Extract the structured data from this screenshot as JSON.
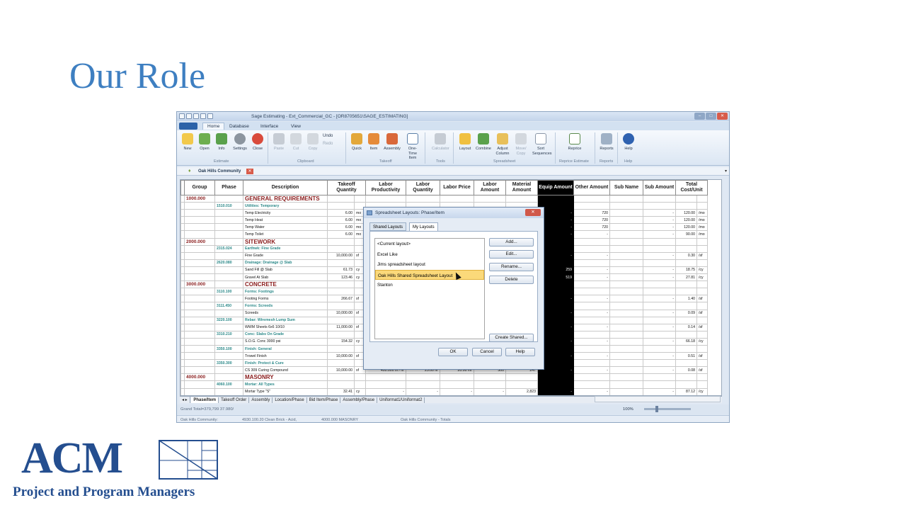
{
  "slide": {
    "title": "Our Role"
  },
  "window": {
    "title": "Sage Estimating - Ext_Commercial_GC - [OR8705651\\SAGE_ESTIMATING]",
    "min_btn": "–",
    "max_btn": "□",
    "close_btn": "✕"
  },
  "ribbon": {
    "tabs": [
      "Home",
      "Database",
      "Interface",
      "View"
    ],
    "buttons": {
      "new": "New",
      "open": "Open",
      "info": "Info",
      "settings": "Settings",
      "close": "Close",
      "paste": "Paste",
      "cut": "Cut",
      "copy": "Copy",
      "undo": "Undo",
      "redo": "Redo",
      "quick": "Quick",
      "item": "Item",
      "assembly": "Assembly",
      "onetime": "One-Time Item",
      "calculator": "Calculator",
      "layout": "Layout",
      "combine": "Combine",
      "adjust": "Adjust Column",
      "movecopy": "Move/ Copy",
      "sort": "Sort Sequences",
      "reprice": "Reprice",
      "reports": "Reports",
      "help": "Help"
    },
    "groups": {
      "estimate": "Estimate",
      "clipboard": "Clipboard",
      "takeoff": "Takeoff",
      "tools": "Tools",
      "spreadsheet": "Spreadsheet",
      "reprice": "Reprice Estimate",
      "reports": "Reports",
      "help": "Help"
    }
  },
  "estimate_bar": {
    "name": "Oak Hills Community",
    "close": "✕",
    "arrow": "▾"
  },
  "grid": {
    "headers": [
      "Group",
      "Phase",
      "Description",
      "Takeoff Quantity",
      "Labor Productivity",
      "Labor Quantity",
      "Labor Price",
      "Labor Amount",
      "Material Amount",
      "Equip Amount",
      "Other Amount",
      "Sub Name",
      "Sub Amount",
      "Total Cost/Unit"
    ],
    "rows": [
      {
        "g": "1000.000",
        "p": "",
        "d": "GENERAL REQUIREMENTS",
        "t": "",
        "u": "",
        "lp": "",
        "lq": "",
        "lpr": "",
        "la": "",
        "ma": "",
        "ea": "",
        "oa": "",
        "sn": "",
        "sa": "",
        "tc": "",
        "tu": "",
        "lvl": 1
      },
      {
        "g": "",
        "p": "1510.010",
        "d": "Utilities: Temporary",
        "t": "",
        "u": "",
        "lp": "",
        "lq": "",
        "lpr": "",
        "la": "",
        "ma": "",
        "ea": "",
        "oa": "",
        "sn": "",
        "sa": "",
        "tc": "",
        "tu": "",
        "lvl": 2
      },
      {
        "g": "",
        "p": "",
        "d": "Temp Electricity",
        "t": "6.00",
        "u": "mo",
        "lp": "",
        "lq": "",
        "lpr": "",
        "la": "",
        "ma": "",
        "ea": "-",
        "oa": "720",
        "sn": "",
        "sa": "-",
        "tc": "120.00",
        "tu": "/mo",
        "lvl": 3
      },
      {
        "g": "",
        "p": "",
        "d": "Temp Heat",
        "t": "6.00",
        "u": "mo",
        "lp": "",
        "lq": "",
        "lpr": "",
        "la": "",
        "ma": "",
        "ea": "-",
        "oa": "720",
        "sn": "",
        "sa": "-",
        "tc": "120.00",
        "tu": "/mo",
        "lvl": 3
      },
      {
        "g": "",
        "p": "",
        "d": "Temp Water",
        "t": "6.00",
        "u": "mo",
        "lp": "",
        "lq": "",
        "lpr": "",
        "la": "",
        "ma": "",
        "ea": "-",
        "oa": "720",
        "sn": "",
        "sa": "-",
        "tc": "120.00",
        "tu": "/mo",
        "lvl": 3
      },
      {
        "g": "",
        "p": "",
        "d": "Temp Toilet",
        "t": "6.00",
        "u": "mo",
        "lp": "",
        "lq": "",
        "lpr": "",
        "la": "",
        "ma": "",
        "ea": "-",
        "oa": "-",
        "sn": "",
        "sa": "-",
        "tc": "90.00",
        "tu": "/mo",
        "lvl": 3
      },
      {
        "g": "2000.000",
        "p": "",
        "d": "SITEWORK",
        "t": "",
        "u": "",
        "lp": "",
        "lq": "",
        "lpr": "",
        "la": "",
        "ma": "",
        "ea": "",
        "oa": "",
        "sn": "",
        "sa": "",
        "tc": "",
        "tu": "",
        "lvl": 1
      },
      {
        "g": "",
        "p": "2315.024",
        "d": "Earthwk: Fine Grade",
        "t": "",
        "u": "",
        "lp": "",
        "lq": "",
        "lpr": "",
        "la": "",
        "ma": "",
        "ea": "",
        "oa": "",
        "sn": "",
        "sa": "",
        "tc": "",
        "tu": "",
        "lvl": 2
      },
      {
        "g": "",
        "p": "",
        "d": "Fine Grade",
        "t": "10,000.00",
        "u": "sf",
        "lp": "",
        "lq": "",
        "lpr": "",
        "la": "",
        "ma": "",
        "ea": "-",
        "oa": "-",
        "sn": "",
        "sa": "-",
        "tc": "0.30",
        "tu": "/sf",
        "lvl": 3
      },
      {
        "g": "",
        "p": "2620.080",
        "d": "Drainage: Drainage @ Slab",
        "t": "",
        "u": "",
        "lp": "",
        "lq": "",
        "lpr": "",
        "la": "",
        "ma": "",
        "ea": "",
        "oa": "",
        "sn": "",
        "sa": "",
        "tc": "",
        "tu": "",
        "lvl": 2
      },
      {
        "g": "",
        "p": "",
        "d": "Sand Fill @ Slab",
        "t": "61.73",
        "u": "cy",
        "lp": "",
        "lq": "",
        "lpr": "",
        "la": "",
        "ma": "",
        "ea": "259",
        "oa": "-",
        "sn": "",
        "sa": "-",
        "tc": "18.75",
        "tu": "/cy",
        "lvl": 3
      },
      {
        "g": "",
        "p": "",
        "d": "Gravel At Slab",
        "t": "123.46",
        "u": "cy",
        "lp": "",
        "lq": "",
        "lpr": "",
        "la": "",
        "ma": "",
        "ea": "519",
        "oa": "-",
        "sn": "",
        "sa": "-",
        "tc": "27.81",
        "tu": "/cy",
        "lvl": 3
      },
      {
        "g": "3000.000",
        "p": "",
        "d": "CONCRETE",
        "t": "",
        "u": "",
        "lp": "",
        "lq": "",
        "lpr": "",
        "la": "",
        "ma": "",
        "ea": "",
        "oa": "",
        "sn": "",
        "sa": "",
        "tc": "",
        "tu": "",
        "lvl": 1
      },
      {
        "g": "",
        "p": "3110.100",
        "d": "Forms: Footings",
        "t": "",
        "u": "",
        "lp": "",
        "lq": "",
        "lpr": "",
        "la": "",
        "ma": "",
        "ea": "",
        "oa": "",
        "sn": "",
        "sa": "",
        "tc": "",
        "tu": "",
        "lvl": 2
      },
      {
        "g": "",
        "p": "",
        "d": "Footing Forms",
        "t": "266.67",
        "u": "sf",
        "lp": "",
        "lq": "",
        "lpr": "",
        "la": "",
        "ma": "",
        "ea": "-",
        "oa": "-",
        "sn": "",
        "sa": "-",
        "tc": "1.40",
        "tu": "/sf",
        "lvl": 3
      },
      {
        "g": "",
        "p": "3111.450",
        "d": "Forms: Screeds",
        "t": "",
        "u": "",
        "lp": "",
        "lq": "",
        "lpr": "",
        "la": "",
        "ma": "",
        "ea": "",
        "oa": "",
        "sn": "",
        "sa": "",
        "tc": "",
        "tu": "",
        "lvl": 2
      },
      {
        "g": "",
        "p": "",
        "d": "Screeds",
        "t": "10,000.00",
        "u": "sf",
        "lp": "",
        "lq": "",
        "lpr": "",
        "la": "",
        "ma": "",
        "ea": "-",
        "oa": "-",
        "sn": "",
        "sa": "-",
        "tc": "0.09",
        "tu": "/sf",
        "lvl": 3
      },
      {
        "g": "",
        "p": "3220.100",
        "d": "Rebar: Wiremesh Lump Sum",
        "t": "",
        "u": "",
        "lp": "",
        "lq": "",
        "lpr": "",
        "la": "",
        "ma": "",
        "ea": "",
        "oa": "",
        "sn": "",
        "sa": "",
        "tc": "",
        "tu": "",
        "lvl": 2
      },
      {
        "g": "",
        "p": "",
        "d": "WWM Sheets 6x6 10/10",
        "t": "11,000.00",
        "u": "sf",
        "lp": "",
        "lq": "",
        "lpr": "",
        "la": "",
        "ma": "",
        "ea": "-",
        "oa": "-",
        "sn": "",
        "sa": "-",
        "tc": "0.14",
        "tu": "/sf",
        "lvl": 3
      },
      {
        "g": "",
        "p": "3310.210",
        "d": "Conc: Slabs On Grade",
        "t": "",
        "u": "",
        "lp": "",
        "lq": "",
        "lpr": "",
        "la": "",
        "ma": "",
        "ea": "",
        "oa": "",
        "sn": "",
        "sa": "",
        "tc": "",
        "tu": "",
        "lvl": 2
      },
      {
        "g": "",
        "p": "",
        "d": "S.O.G. Conc 3000 psi",
        "t": "154.32",
        "u": "cy",
        "lp": "",
        "lq": "",
        "lpr": "",
        "la": "",
        "ma": "",
        "ea": "-",
        "oa": "-",
        "sn": "",
        "sa": "-",
        "tc": "66.18",
        "tu": "/cy",
        "lvl": 3
      },
      {
        "g": "",
        "p": "3350.100",
        "d": "Finish: General",
        "t": "",
        "u": "",
        "lp": "",
        "lq": "",
        "lpr": "",
        "la": "",
        "ma": "",
        "ea": "",
        "oa": "",
        "sn": "",
        "sa": "",
        "tc": "",
        "tu": "",
        "lvl": 2
      },
      {
        "g": "",
        "p": "",
        "d": "Trowel Finish",
        "t": "10,000.00",
        "u": "sf",
        "lp": "",
        "lq": "",
        "lpr": "",
        "la": "",
        "ma": "",
        "ea": "-",
        "oa": "-",
        "sn": "",
        "sa": "-",
        "tc": "0.51",
        "tu": "/sf",
        "lvl": 3
      },
      {
        "g": "",
        "p": "3350.300",
        "d": "Finish: Protect & Cure",
        "t": "",
        "u": "",
        "lp": "",
        "lq": "",
        "lpr": "",
        "la": "",
        "ma": "",
        "ea": "",
        "oa": "",
        "sn": "",
        "sa": "",
        "tc": "",
        "tu": "",
        "lvl": 2
      },
      {
        "g": "",
        "p": "",
        "d": "CS 309 Curing Compound",
        "t": "10,000.00",
        "u": "sf",
        "lp": "400.000 sf / hr",
        "lq": "25.00 hr",
        "lpr": "20.00 /hr",
        "la": "500",
        "ma": "247",
        "ea": "-",
        "oa": "-",
        "sn": "",
        "sa": "-",
        "tc": "0.08",
        "tu": "/sf",
        "lvl": 3
      },
      {
        "g": "4000.000",
        "p": "",
        "d": "MASONRY",
        "t": "",
        "u": "",
        "lp": "",
        "lq": "",
        "lpr": "",
        "la": "",
        "ma": "",
        "ea": "",
        "oa": "",
        "sn": "",
        "sa": "",
        "tc": "",
        "tu": "",
        "lvl": 1
      },
      {
        "g": "",
        "p": "4060.100",
        "d": "Mortar: All Types",
        "t": "",
        "u": "",
        "lp": "",
        "lq": "",
        "lpr": "",
        "la": "",
        "ma": "",
        "ea": "",
        "oa": "",
        "sn": "",
        "sa": "",
        "tc": "",
        "tu": "",
        "lvl": 2
      },
      {
        "g": "",
        "p": "",
        "d": "Mortar Type \"S\"",
        "t": "32.41",
        "u": "cy",
        "lp": "-",
        "lq": "-",
        "lpr": "-",
        "la": "-",
        "ma": "2,823",
        "ea": "-",
        "oa": "-",
        "sn": "",
        "sa": "-",
        "tc": "87.12",
        "tu": "/cy",
        "lvl": 3
      }
    ]
  },
  "sheet_tabs": [
    "Phase/Item",
    "Takeoff Order",
    "Assembly",
    "Location/Phase",
    "Bid Item/Phase",
    "Assembly/Phase",
    "Uniformat1/Uniformat2"
  ],
  "status": {
    "grand_total": "Grand Total=379,799    37.980/",
    "zoom": "100%"
  },
  "footer": {
    "left": "Oak Hills Community:",
    "mid1": "4930.100.20 Clean Brick - Acid,",
    "mid2": "4000.000 MASONRY",
    "right": "Oak Hills Community - Totals"
  },
  "dialog": {
    "title": "Spreadsheet Layouts: Phase/Item",
    "close": "✕",
    "tabs": [
      "Shared Layouts",
      "My Layouts"
    ],
    "active_tab": "My Layouts",
    "items": [
      "<Current layout>",
      "Excel Like",
      "Jims spreadsheet layout",
      "Oak Hills Shared Spreadsheet Layout",
      "Stanton"
    ],
    "selected": "Oak Hills Shared Spreadsheet Layout",
    "buttons": {
      "add": "Add...",
      "edit": "Edit...",
      "rename": "Rename...",
      "delete": "Delete",
      "create_shared": "Create Shared...",
      "ok": "OK",
      "cancel": "Cancel",
      "help": "Help"
    }
  },
  "logo": {
    "letters": "ACM",
    "tagline": "Project and Program Managers",
    "color": "#244e8f"
  }
}
